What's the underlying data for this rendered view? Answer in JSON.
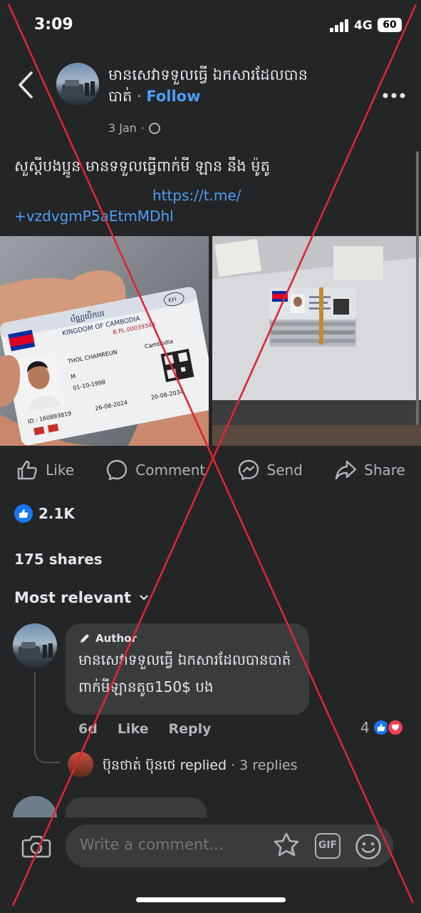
{
  "status_bar": {
    "time": "3:09",
    "network": "4G",
    "battery": "60"
  },
  "post": {
    "page_name": "មានសេវាទទួលធ្វើ ឯកសារដែលបាន",
    "page_name_cont": "បាត់",
    "separator": " · ",
    "follow_label": "Follow",
    "date": "3 Jan",
    "dot": "·",
    "text": "សួស្តីបងប្អូន មានទទួលធ្វើពាក់មី ឡាន នឹង ម៉ូតូ",
    "link_part1": "https://t.me/",
    "link_part2": "+vzdvgmP5aEtmMDhl",
    "image_left": {
      "card_title": "ប័ណ្ណបើកបរ",
      "card_country": "KINGDOM OF CAMBODIA",
      "card_code": "KH",
      "card_number": "B.PL.00039348",
      "holder_name": "THOL CHAMREUN",
      "nationality": "Cambodia",
      "sex": "M",
      "birth_date": "01-10-1998",
      "id": "ID : 160893819",
      "issue_date": "26-08-2024",
      "expiry_date": "20-08-2034"
    }
  },
  "actions": {
    "like": "Like",
    "comment": "Comment",
    "send": "Send",
    "share": "Share"
  },
  "stats": {
    "reactions": "2.1K",
    "shares": "175 shares"
  },
  "sort_label": "Most relevant",
  "comment": {
    "author_badge": "Author",
    "line1": "មានសេវាទទួលធ្វើ ឯកសារដែលបានបាត់",
    "line2": "ពាក់មីឡានតូច150$ បង",
    "time": "6d",
    "like": "Like",
    "reply": "Reply",
    "reaction_count": "4",
    "reply_author": "ប៊ុនថាត់ ប៊ុនថេ",
    "reply_action": " replied",
    "reply_count": " · 3 replies"
  },
  "composer": {
    "placeholder": "Write a comment...",
    "gif": "GIF"
  },
  "colors": {
    "background": "#242526",
    "accent": "#4e9cf5",
    "overlay_x": "#e0242e"
  }
}
